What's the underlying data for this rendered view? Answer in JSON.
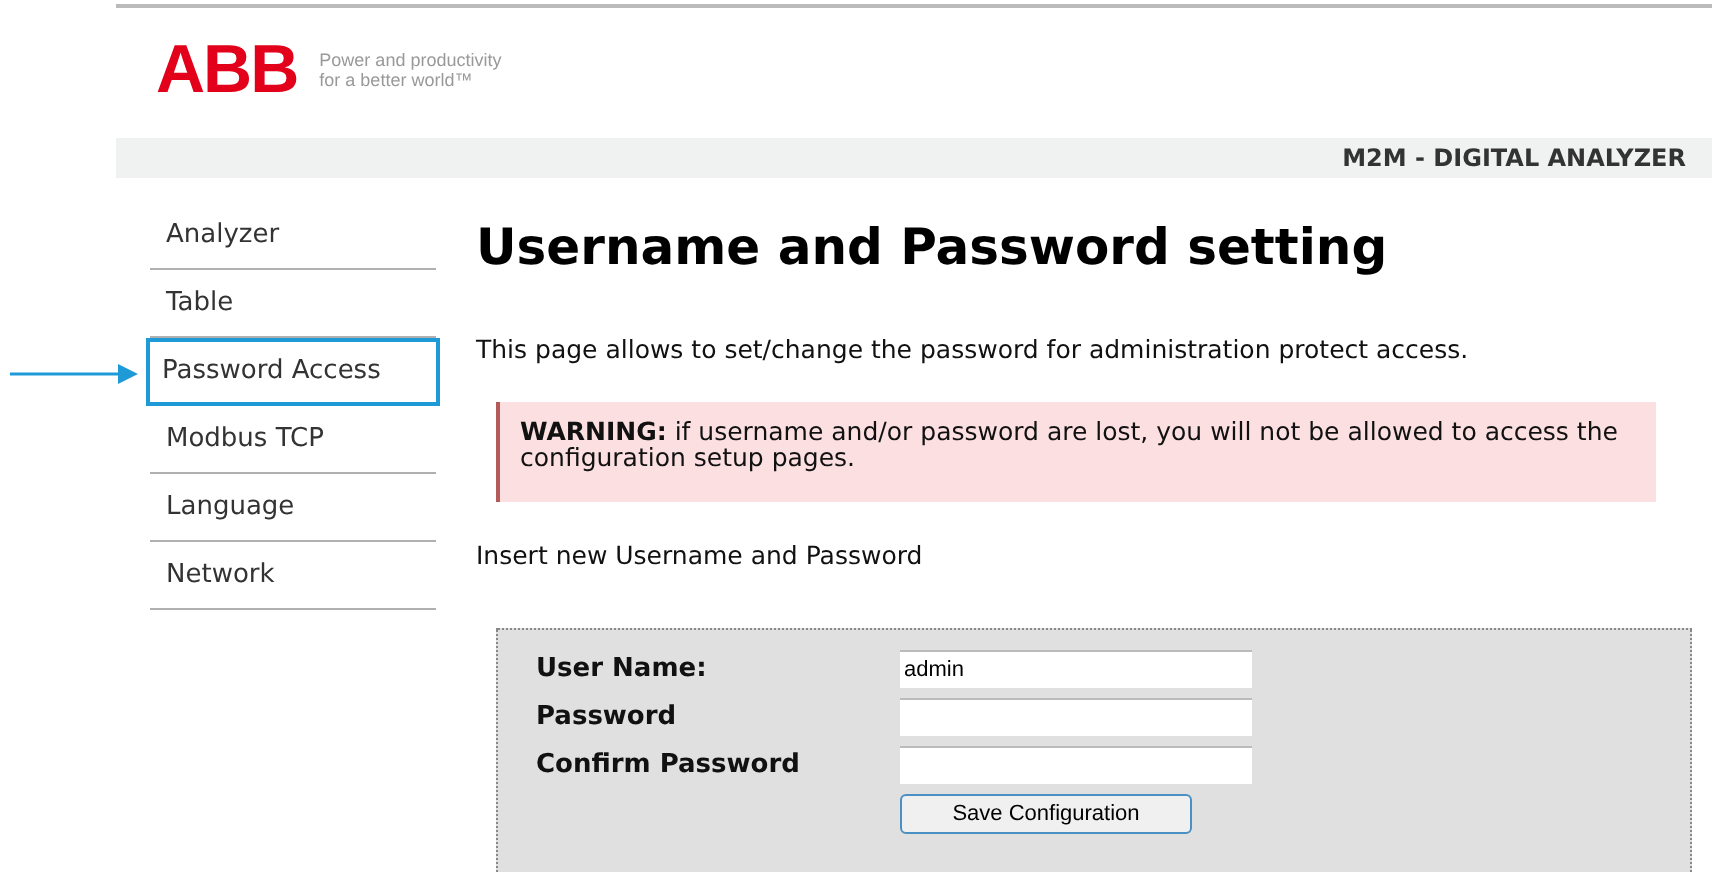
{
  "header": {
    "logo": "ABB",
    "tagline_lines": [
      "Power and productivity",
      "for a better world™"
    ],
    "product_title": "M2M - DIGITAL ANALYZER"
  },
  "sidebar": {
    "items": [
      {
        "label": "Analyzer",
        "selected": false
      },
      {
        "label": "Table",
        "selected": false
      },
      {
        "label": "Password Access",
        "selected": true
      },
      {
        "label": "Modbus TCP",
        "selected": false
      },
      {
        "label": "Language",
        "selected": false
      },
      {
        "label": "Network",
        "selected": false
      }
    ]
  },
  "main": {
    "heading": "Username and Password setting",
    "intro": "This page allows to set/change the password for administration protect access.",
    "warning": "**WARNING:** if username and/or password are lost, you will not be allowed to access the configuration setup pages.",
    "instruction": "Insert new Username and Password",
    "form": {
      "fields": [
        {
          "label": "User Name:",
          "value": "admin"
        },
        {
          "label": "Password"
        },
        {
          "label": "Confirm Password"
        }
      ],
      "button": "Save Configuration"
    }
  }
}
